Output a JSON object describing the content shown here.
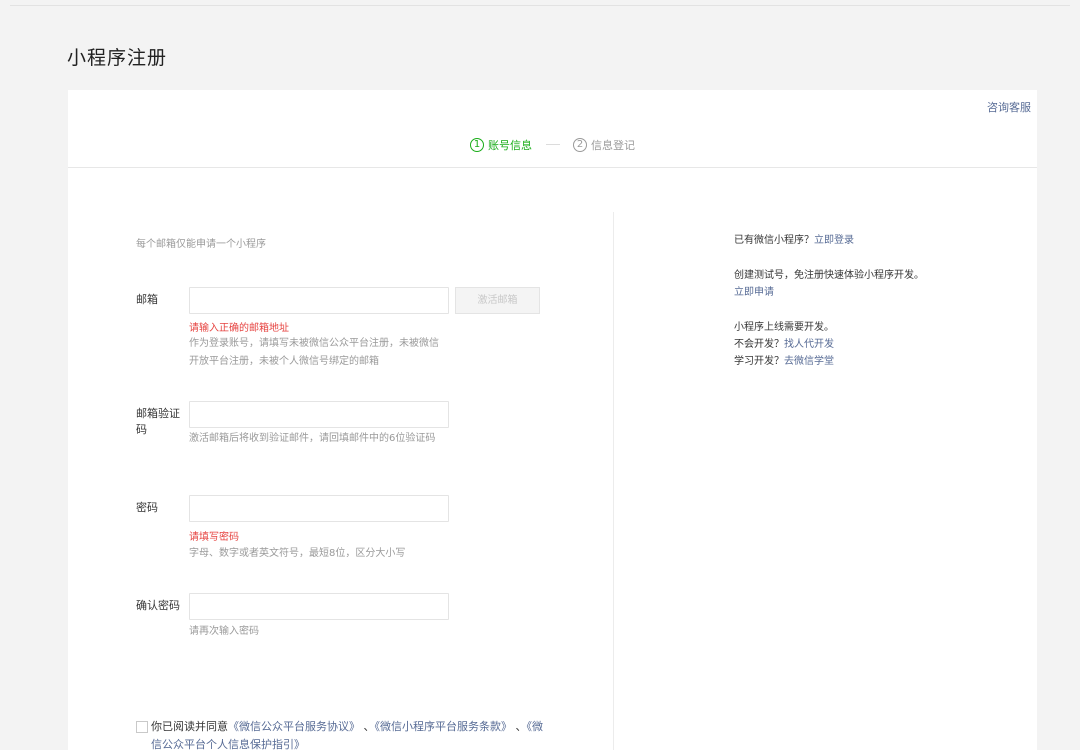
{
  "page": {
    "title": "小程序注册"
  },
  "header": {
    "service_link": "咨询客服"
  },
  "steps": [
    {
      "num": "1",
      "label": "账号信息"
    },
    {
      "num": "2",
      "label": "信息登记"
    }
  ],
  "form": {
    "tip": "每个邮箱仅能申请一个小程序",
    "email": {
      "label": "邮箱",
      "value": "",
      "activate_button": "激活邮箱",
      "error": "请输入正确的邮箱地址",
      "hint": "作为登录账号，请填写未被微信公众平台注册，未被微信开放平台注册，未被个人微信号绑定的邮箱"
    },
    "verify_code": {
      "label": "邮箱验证码",
      "value": "",
      "hint": "激活邮箱后将收到验证邮件，请回填邮件中的6位验证码"
    },
    "password": {
      "label": "密码",
      "value": "",
      "error": "请填写密码",
      "hint": "字母、数字或者英文符号，最短8位，区分大小写"
    },
    "confirm_password": {
      "label": "确认密码",
      "value": "",
      "hint": "请再次输入密码"
    },
    "agreement": {
      "prefix": "你已阅读并同意",
      "link1": "《微信公众平台服务协议》",
      "sep1": "、",
      "link2": "《微信小程序平台服务条款》",
      "sep2": "、",
      "link3": "《微信公众平台个人信息保护指引》"
    }
  },
  "sidebar": {
    "login_text": "已有微信小程序？",
    "login_link": "立即登录",
    "test_text": "创建测试号，免注册快速体验小程序开发。",
    "test_link": "立即申请",
    "dev_text": "小程序上线需要开发。",
    "no_dev_text": "不会开发？",
    "no_dev_link": "找人代开发",
    "learn_text": "学习开发？",
    "learn_link": "去微信学堂"
  },
  "colors": {
    "accent": "#1aad19",
    "link": "#576b95",
    "error": "#e64340"
  }
}
